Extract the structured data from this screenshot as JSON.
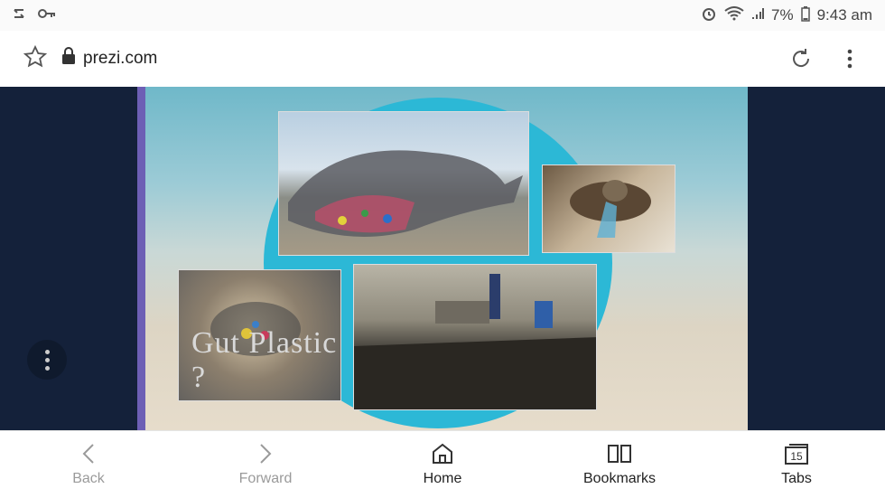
{
  "status_bar": {
    "left_icons": [
      "usb-transfer-icon",
      "key-icon"
    ],
    "right_icons": [
      "alarm-icon",
      "wifi-icon",
      "signal-icon",
      "battery-icon"
    ],
    "battery": "7%",
    "time": "9:43 am"
  },
  "url_bar": {
    "url": "prezi.com",
    "icons": [
      "star-icon",
      "lock-icon",
      "reload-icon",
      "more-vertical-icon"
    ]
  },
  "slide": {
    "bird_caption": "Gut Plastic ?",
    "accent_color": "#2cb8d6"
  },
  "bottom_nav": [
    {
      "label": "Back",
      "icon": "chevron-left-icon",
      "enabled": false
    },
    {
      "label": "Forward",
      "icon": "chevron-right-icon",
      "enabled": false
    },
    {
      "label": "Home",
      "icon": "home-icon",
      "enabled": true
    },
    {
      "label": "Bookmarks",
      "icon": "book-icon",
      "enabled": true
    },
    {
      "label": "Tabs",
      "icon": "tabs-icon",
      "enabled": true,
      "count": "15"
    }
  ]
}
